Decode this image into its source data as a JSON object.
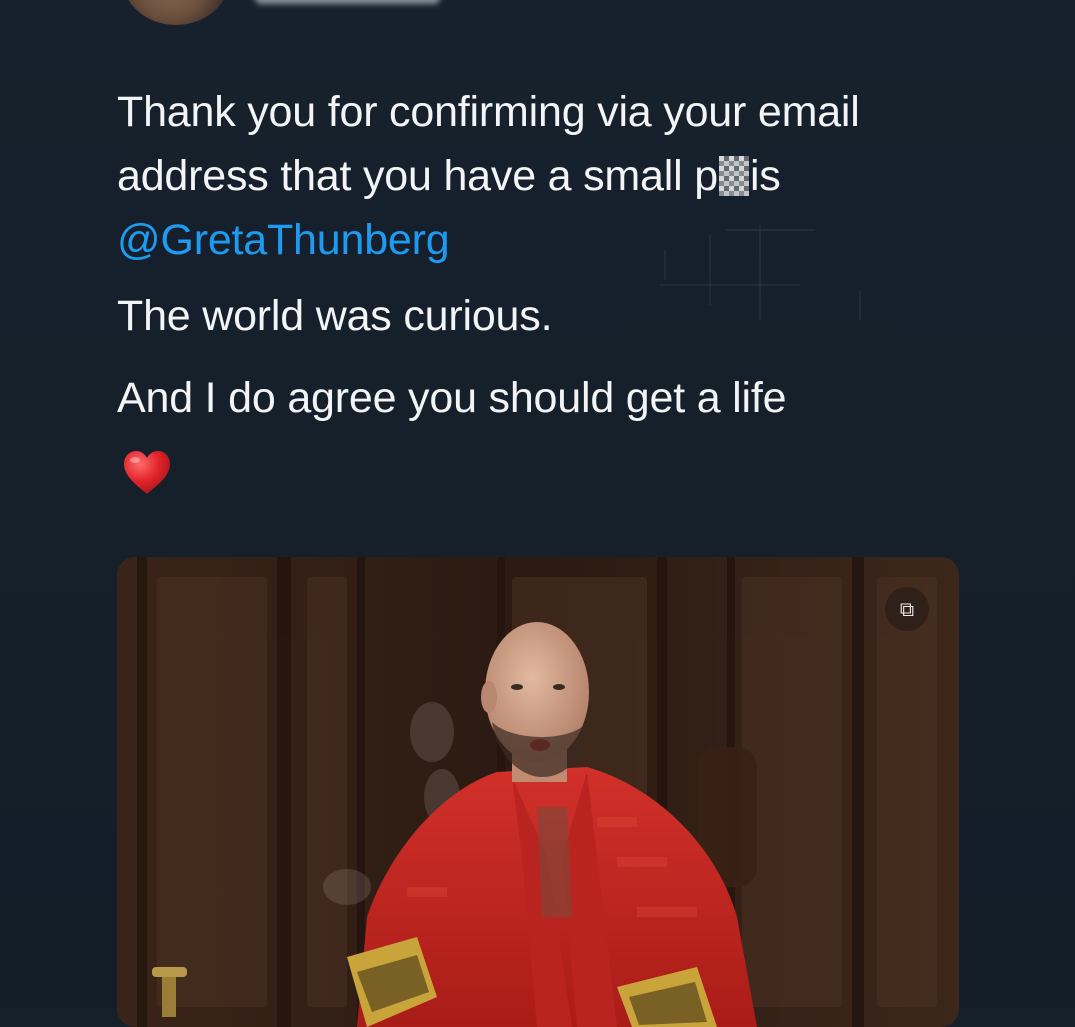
{
  "tweet": {
    "author_name": "",
    "text": {
      "line1_before_mention": "Thank you for confirming via your email address that you have a small p",
      "censored_part": "",
      "line1_after_censor": "is ",
      "mention": "@GretaThunberg",
      "paragraph2": "The world was curious.",
      "paragraph3": "And I do agree you should get a life"
    },
    "emoji": "heart-emoji",
    "media": {
      "type": "gif",
      "badge_icon": "gif-badge-icon"
    }
  },
  "colors": {
    "background": "#15202b",
    "text": "#f2f4f6",
    "mention": "#1d9bf0",
    "heart": "#e0242b",
    "robe": "#c8241f"
  }
}
